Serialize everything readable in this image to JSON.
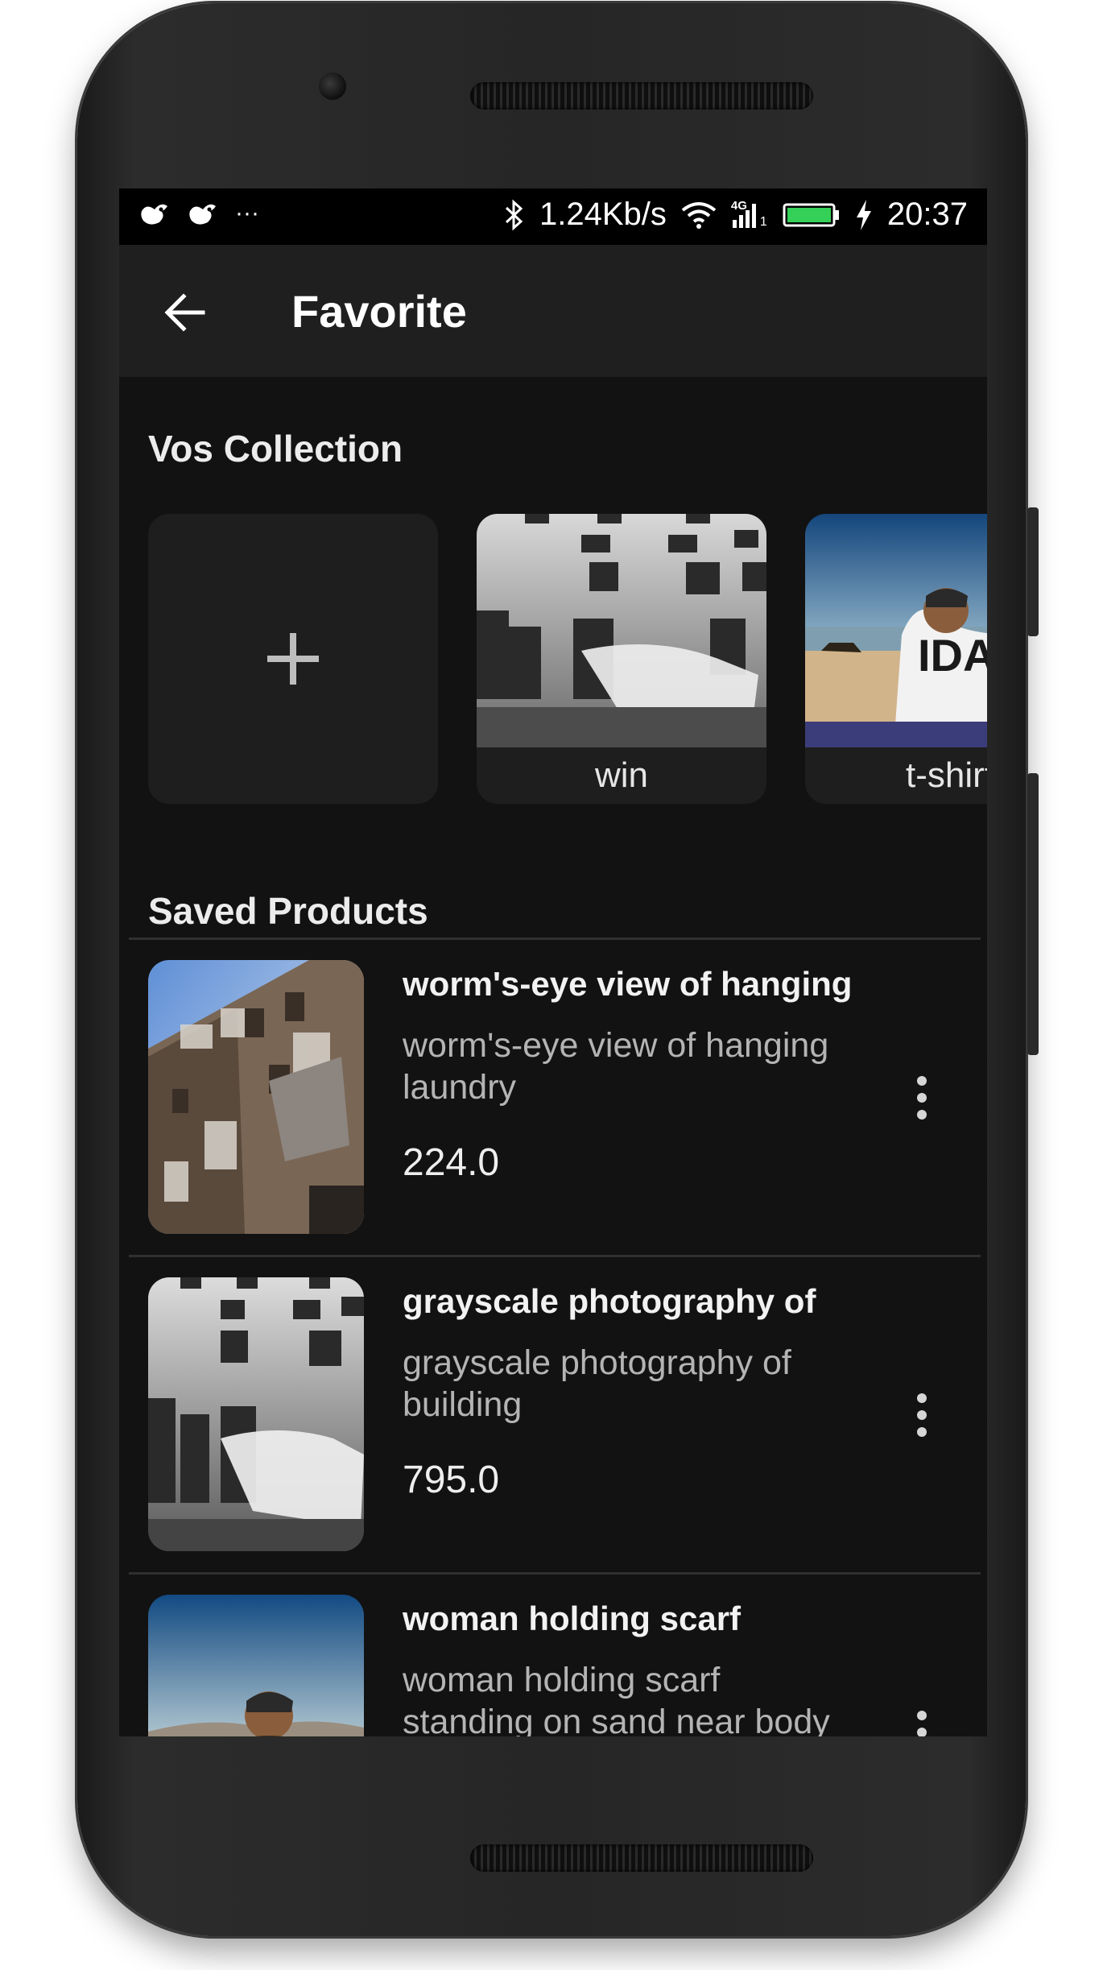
{
  "status_bar": {
    "net_speed": "1.24Kb/s",
    "time": "20:37",
    "dots": "···",
    "network": "4G",
    "sim": "1",
    "battery_color": "#34d058"
  },
  "appbar": {
    "title": "Favorite",
    "back_icon": "arrow-back-icon"
  },
  "collection": {
    "heading": "Vos Collection",
    "add_icon": "plus-icon",
    "items": [
      {
        "label": "win"
      },
      {
        "label": "t-shirt"
      }
    ]
  },
  "saved": {
    "heading": "Saved Products",
    "products": [
      {
        "title": "worm's-eye view of hanging",
        "description": "worm's-eye view of hanging laundry",
        "price": "224.0"
      },
      {
        "title": "grayscale photography of",
        "description": "grayscale photography of building",
        "price": "795.0"
      },
      {
        "title": "woman holding scarf",
        "description": "woman holding scarf standing on sand near body",
        "price": ""
      }
    ]
  },
  "colors": {
    "screen_bg": "#121212",
    "appbar_bg": "#1f1f1f",
    "card_bg": "#1e1e1e",
    "text_primary": "#ffffff",
    "text_secondary": "#b4b4b4"
  }
}
